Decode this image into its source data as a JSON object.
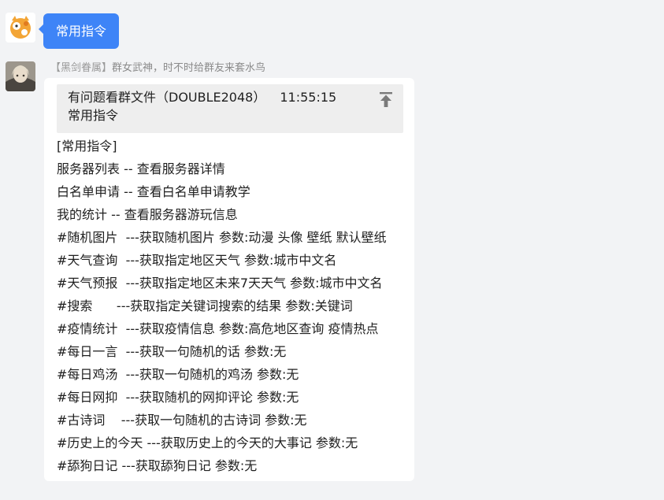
{
  "messages": [
    {
      "avatar_icon": "orange-cat-avatar-icon",
      "text": "常用指令",
      "bubble_color": "#3e84f7"
    },
    {
      "avatar_icon": "anime-character-avatar-icon",
      "sender": {
        "title": "【黑剑眷属】",
        "name": "群女武神，时不时给群友来套水鸟"
      },
      "quote": {
        "source": "有问题看群文件（DOUBLE2048）",
        "time": "11:55:15",
        "text": "常用指令",
        "pin_icon": "pin-to-top-icon"
      },
      "lines": [
        "[常用指令]",
        "服务器列表 -- 查看服务器详情",
        "白名单申请 -- 查看白名单申请教学",
        "我的统计 -- 查看服务器游玩信息",
        "#随机图片  ---获取随机图片 参数:动漫 头像 壁纸 默认壁纸",
        "#天气查询  ---获取指定地区天气 参数:城市中文名",
        "#天气预报  ---获取指定地区未来7天天气 参数:城市中文名",
        "#搜索      ---获取指定关键词搜索的结果 参数:关键词",
        "#疫情统计  ---获取疫情信息 参数:高危地区查询 疫情热点",
        "#每日一言  ---获取一句随机的话 参数:无",
        "#每日鸡汤  ---获取一句随机的鸡汤 参数:无",
        "#每日网抑  ---获取随机的网抑评论 参数:无",
        "#古诗词    ---获取一句随机的古诗词 参数:无",
        "#历史上的今天 ---获取历史上的今天的大事记 参数:无",
        "#舔狗日记 ---获取舔狗日记 参数:无"
      ]
    }
  ]
}
